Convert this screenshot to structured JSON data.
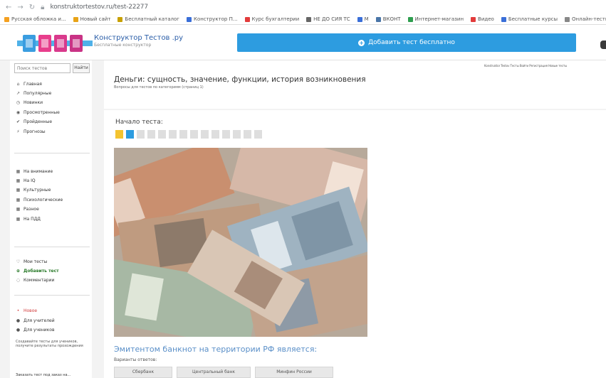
{
  "browser": {
    "url": "konstruktortestov.ru/test-22277",
    "bookmarks": [
      {
        "label": "Русская обложка и...",
        "color": "#f4a020"
      },
      {
        "label": "Новый сайт",
        "color": "#e8a317"
      },
      {
        "label": "Бесплатный каталог",
        "color": "#c8a000"
      },
      {
        "label": "Конструктор П...",
        "color": "#3a6fd8"
      },
      {
        "label": "Курс бухгалтерии",
        "color": "#e23b3b"
      },
      {
        "label": "НЕ ДО СИЯ ТС",
        "color": "#666666"
      },
      {
        "label": "М",
        "color": "#3a6fd8"
      },
      {
        "label": "ВКОНТ",
        "color": "#4a76a8"
      },
      {
        "label": "Интернет-магазин",
        "color": "#2e9e4f"
      },
      {
        "label": "Видео",
        "color": "#e23b3b"
      },
      {
        "label": "Бесплатные курсы",
        "color": "#3a6fd8"
      },
      {
        "label": "Онлайн-тесты",
        "color": "#888888"
      }
    ]
  },
  "header": {
    "logo_title": "Конструктор Тестов .ру",
    "logo_subtitle": "Бесплатные конструктор",
    "add_test_button": "Добавить тест бесплатно"
  },
  "sidebar": {
    "search_placeholder": "Поиск тестов",
    "search_button": "Найти",
    "menu": [
      {
        "label": "Главная",
        "icon": "home-icon",
        "glyph": "⌂"
      },
      {
        "label": "Популярные",
        "icon": "chart-icon",
        "glyph": "↗"
      },
      {
        "label": "Новинки",
        "icon": "clock-icon",
        "glyph": "◷"
      },
      {
        "label": "Просмотренные",
        "icon": "eye-icon",
        "glyph": "◉"
      },
      {
        "label": "Пройденные",
        "icon": "thumbs-up-icon",
        "glyph": "✔"
      },
      {
        "label": "Прогнозы",
        "icon": "bolt-icon",
        "glyph": "⚡"
      }
    ],
    "categories": [
      {
        "label": "На внимание",
        "icon": "grid-icon",
        "glyph": "▦"
      },
      {
        "label": "На IQ",
        "icon": "grid-icon",
        "glyph": "▦"
      },
      {
        "label": "Культурные",
        "icon": "grid-icon",
        "glyph": "▦"
      },
      {
        "label": "Психологические",
        "icon": "grid-icon",
        "glyph": "▦"
      },
      {
        "label": "Разное",
        "icon": "grid-icon",
        "glyph": "▦"
      },
      {
        "label": "На ПДД",
        "icon": "grid-icon",
        "glyph": "▦"
      }
    ],
    "user": [
      {
        "label": "Мои тесты",
        "icon": "heart-icon",
        "glyph": "♡",
        "active": false
      },
      {
        "label": "Добавить тест",
        "icon": "plus-circle-icon",
        "glyph": "⊕",
        "active": true
      },
      {
        "label": "Комментарии",
        "icon": "comment-icon",
        "glyph": "◌",
        "active": false
      }
    ],
    "new_label": "Новое",
    "extra": [
      {
        "label": "Для учителей",
        "icon": "chat-icon",
        "glyph": "●"
      },
      {
        "label": "Для учеников",
        "icon": "chat-icon",
        "glyph": "●"
      }
    ],
    "note": "Создавайте тесты для учеников, получите результаты прохождения",
    "footer": "Заказать тест под заказ на..."
  },
  "main": {
    "top_links": "Konstruktor Testov Тесты Войти Регистрация Новые тесты",
    "title": "Деньги: сущность, значение, функции, история возникновения",
    "subtitle": "Вопросы для тестов по категориям (страниц 1)",
    "start_label": "Начало теста:",
    "steps": [
      {
        "state": "done",
        "color": "#f4c430"
      },
      {
        "state": "current",
        "color": "#2d9ce0"
      },
      {
        "state": "pending",
        "color": "#dedede"
      },
      {
        "state": "pending",
        "color": "#dedede"
      },
      {
        "state": "pending",
        "color": "#dedede"
      },
      {
        "state": "pending",
        "color": "#dedede"
      },
      {
        "state": "pending",
        "color": "#dedede"
      },
      {
        "state": "pending",
        "color": "#dedede"
      },
      {
        "state": "pending",
        "color": "#dedede"
      },
      {
        "state": "pending",
        "color": "#dedede"
      },
      {
        "state": "pending",
        "color": "#dedede"
      },
      {
        "state": "pending",
        "color": "#dedede"
      },
      {
        "state": "pending",
        "color": "#dedede"
      },
      {
        "state": "pending",
        "color": "#dedede"
      }
    ],
    "image_alt": "Банкноты 5000 и 1000 рублей",
    "question": "Эмитентом банкнот на территории РФ является:",
    "answer_hint": "Варианты ответов:",
    "answers": [
      "Сбербанк",
      "Центральный банк",
      "Минфин России"
    ]
  },
  "colors": {
    "accent": "#2d9ce0",
    "question": "#5a8fc8",
    "active_menu": "#2a7a2a"
  }
}
